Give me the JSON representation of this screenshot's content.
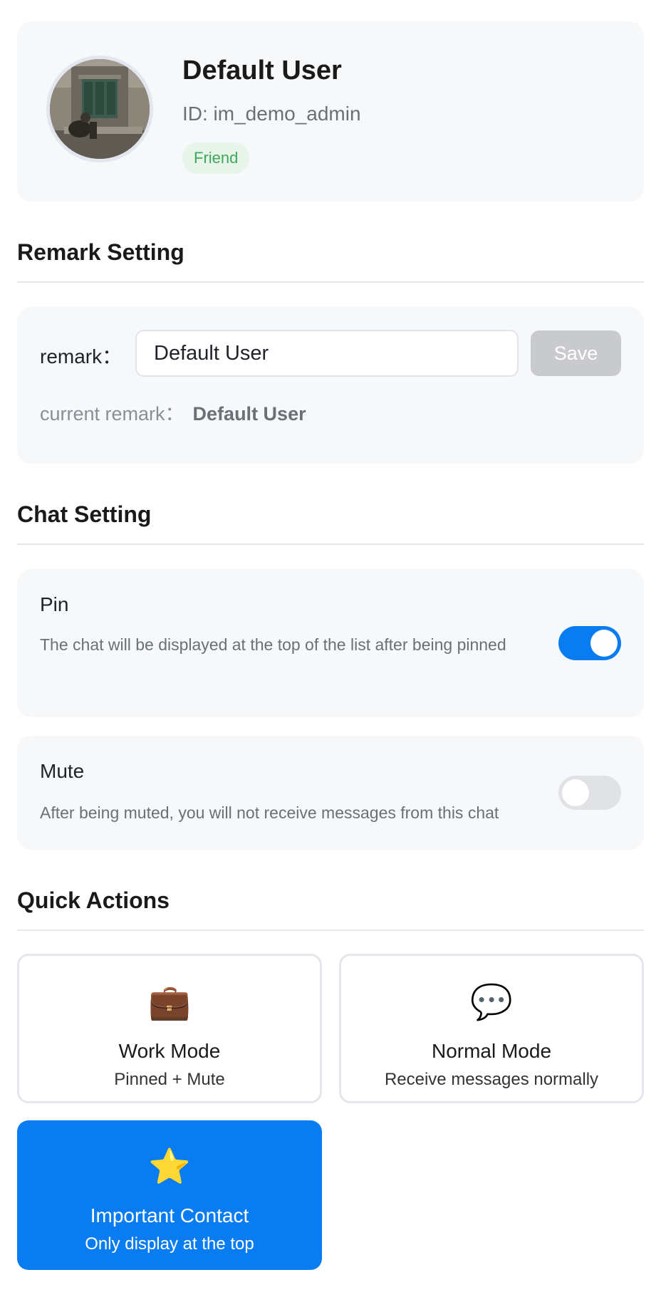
{
  "profile": {
    "name": "Default User",
    "id_text": "ID: im_demo_admin",
    "badge": "Friend"
  },
  "remark_section": {
    "title": "Remark Setting",
    "label": "remark：",
    "input_value": "Default User",
    "save_label": "Save",
    "current_label": "current remark：",
    "current_value": "Default User"
  },
  "chat_section": {
    "title": "Chat Setting",
    "pin": {
      "title": "Pin",
      "description": "The chat will be displayed at the top of the list after being pinned",
      "enabled": true
    },
    "mute": {
      "title": "Mute",
      "description": "After being muted, you will not receive messages from this chat",
      "enabled": false
    }
  },
  "quick_actions": {
    "title": "Quick Actions",
    "items": [
      {
        "emoji": "💼",
        "icon": "briefcase-icon",
        "title": "Work Mode",
        "subtitle": "Pinned + Mute"
      },
      {
        "emoji": "💬",
        "icon": "speech-bubble-icon",
        "title": "Normal Mode",
        "subtitle": "Receive messages normally"
      },
      {
        "emoji": "⭐",
        "icon": "star-icon",
        "title": "Important Contact",
        "subtitle": "Only display at the top"
      }
    ]
  },
  "colors": {
    "primary": "#0a7cf2",
    "badge_bg": "#e6f4e9",
    "badge_text": "#3fa85a",
    "card_bg": "#f7f8fa",
    "disabled_button": "#c9cacd"
  }
}
